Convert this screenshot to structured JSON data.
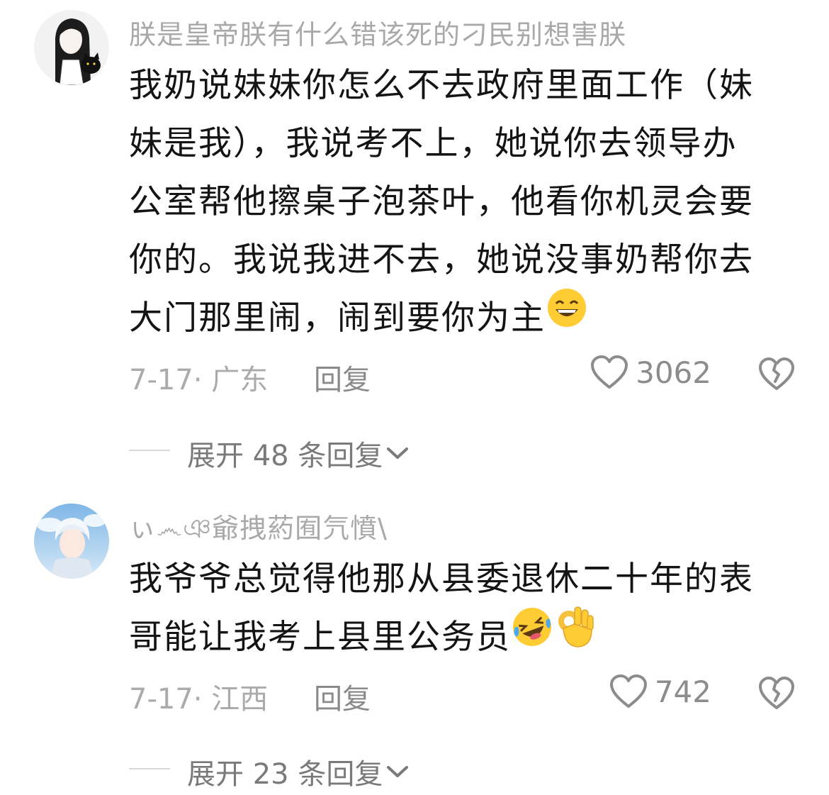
{
  "comments": [
    {
      "username": "朕是皇帝朕有什么错该死的刁民别想害朕",
      "lines": [
        "我奶说妹妹你怎么不去政府里面工作（妹",
        "妹是我），我说考不上，她说你去领导办",
        "公室帮他擦桌子泡茶叶，他看你机灵会要",
        "你的。我说我进不去，她说没事奶帮你去",
        "大门那里闹，闹到要你为主"
      ],
      "emojis": [
        "grinning-sweat-emoji"
      ],
      "date_location": "7-17· 广东",
      "reply_label": "回复",
      "likes": "3062",
      "expand_label": "展开 48 条回复"
    },
    {
      "username": "ぃ෴ঞ爺拽葯囿氕憤\\",
      "lines": [
        "我爷爷总觉得他那从县委退休二十年的表",
        "哥能让我考上县里公务员"
      ],
      "emojis": [
        "rolling-laughing-emoji",
        "ok-hand-emoji"
      ],
      "date_location": "7-17· 江西",
      "reply_label": "回复",
      "likes": "742",
      "expand_label": "展开 23 条回复"
    }
  ],
  "colors": {
    "text": "#141414",
    "username": "#a9a9a9",
    "meta": "#ababab",
    "emoji_yellow": "#ffcc33"
  }
}
